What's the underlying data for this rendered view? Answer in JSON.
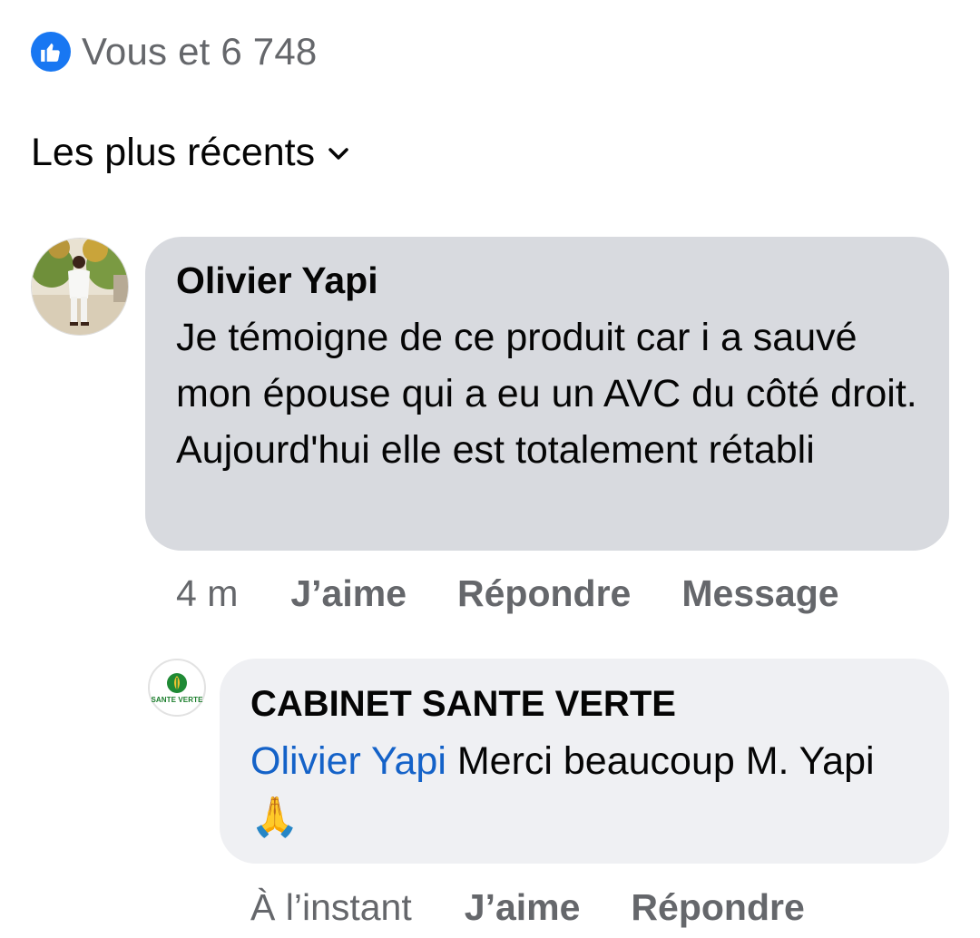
{
  "reactions": {
    "text": "Vous et 6 748",
    "icon": "like-icon",
    "badge_color": "#1877f2"
  },
  "sort": {
    "label": "Les plus récents",
    "icon": "chevron-down-icon"
  },
  "comment": {
    "author": "Olivier Yapi",
    "text": "Je témoigne de ce produit car i a sauvé mon épouse qui a eu un AVC du côté droit. Aujourd'hui elle est totalement rétabli",
    "time": "4 m",
    "actions": {
      "like": "J’aime",
      "reply": "Répondre",
      "message": "Message"
    },
    "bubble_color": "#d8dadf"
  },
  "reply": {
    "author": "CABINET SANTE VERTE",
    "avatar_text": "SANTE VERTE",
    "mention": "Olivier Yapi",
    "text": " Merci beaucoup M. Yapi 🙏",
    "time": "À l’instant",
    "actions": {
      "like": "J’aime",
      "reply": "Répondre"
    },
    "mention_color": "#1462c8",
    "bubble_color": "#eff0f3"
  }
}
